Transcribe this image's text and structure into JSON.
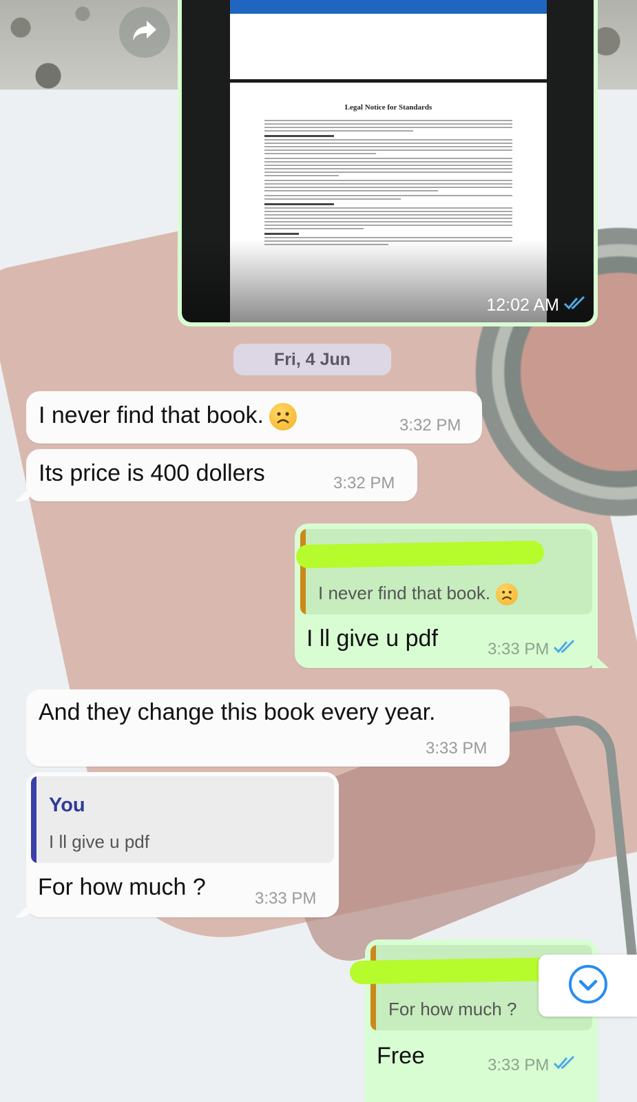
{
  "colors": {
    "outgoing_bubble": "#d9fdd3",
    "incoming_bubble": "#fbfbfb",
    "read_ticks": "#4fa9e6",
    "reply_bar_self": "#c98a1a",
    "reply_bar_you": "#3b3fa8",
    "redaction": "#b6fb2c"
  },
  "icons": {
    "forward": "forward-arrow-icon",
    "read_receipt": "double-check-icon",
    "scroll_down": "chevron-down-circle-icon",
    "emoji": "frowning-face-emoji"
  },
  "image_message": {
    "doc_title": "Legal Notice for Standards",
    "time": "12:02 AM"
  },
  "date_separator": "Fri, 4 Jun",
  "messages": [
    {
      "text": "I never find that book.",
      "time": "3:32 PM"
    },
    {
      "text": "Its price is 400 dollers",
      "time": "3:32 PM"
    },
    {
      "quote_text": "I never find that book.",
      "text": "I ll give u pdf",
      "time": "3:33 PM"
    },
    {
      "text": "And they change this book every year.",
      "time": "3:33 PM"
    },
    {
      "quote_author": "You",
      "quote_text": "I ll give u pdf",
      "text": "For how much ?",
      "time": "3:33 PM"
    },
    {
      "quote_text": "For how much ?",
      "text": "Free",
      "time": "3:33 PM"
    }
  ]
}
